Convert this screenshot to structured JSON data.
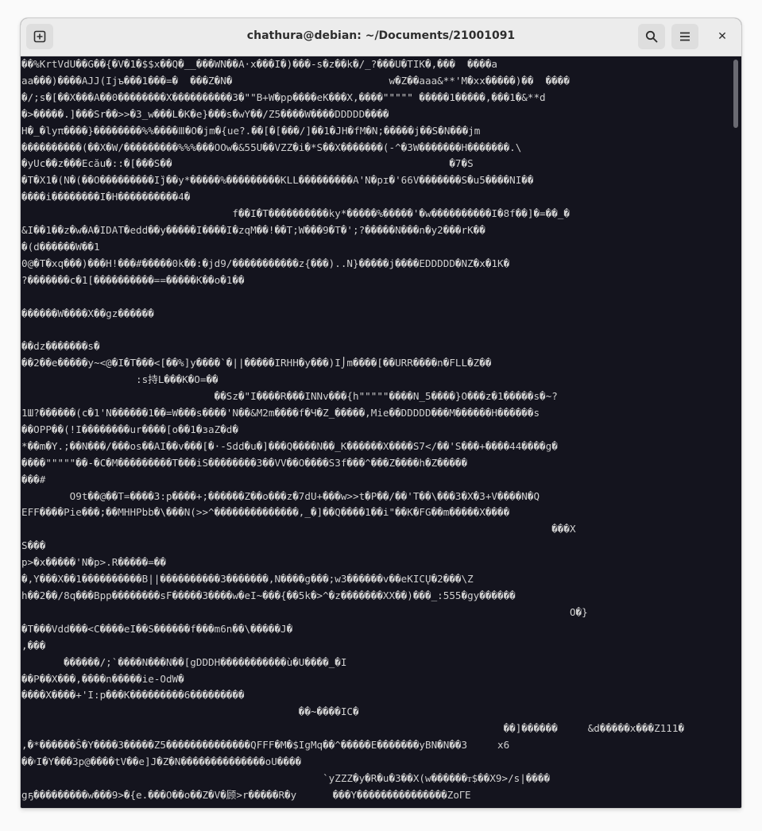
{
  "window": {
    "title": "chathura@debian: ~/Documents/21001091"
  },
  "header": {
    "new_tab_icon": "plus-square-icon",
    "search_icon": "magnifier-icon",
    "menu_icon": "hamburger-icon",
    "close_label": "✕"
  },
  "terminal": {
    "lines": [
      "��%KrtVdU��G��{�V�1�$$x��Q�__���WN��A·x���I�)���-s�z��k�/_?���U�TIK�,���  ����a",
      "aa���)����AJJ(Ijъ���1���=�  ���Z�N�                          w�Z��aaa&**'M�xx�����)��  ����",
      "�/;s�[��X���A��0��������X����������3�\"\"B+W�pp����eK���X,����\"\"\"\"\" �����1�����,���1�&**d",
      "�>�����.]���Sr��>>�3_w���L�K�e}���s�wY��/Z5����W����DDDDD����",
      "H�_�lyπ����}��������%%����Ⅲ�O�jm�{ue?.��[�[���/]��1�JH�fM�N;�����j��S�N���jm",
      "����������(��X�W/���������%%%���OOw�&55U��VZZ�i�*S��X�������(-^�3W�������H�������.\\",
      "�yUc��z���Ecău�::�[���S��                                              �7�S",
      "�T�X1�(N�(��O���������Ij̏��y*�����%���������KLL���������A'N�pɪ�'66V�������S�u5����NI��",
      "����i��������I�H����������4�",
      "                                   f��I�T����������ky*�����%�����'�w����������I�8f��]�=��_�",
      "&I��1��z�w�A�IDAT�edd��y�����I����I�zqM��!��T;W���9�T�';?�����N���n�y2���rK��",
      "�(d������W��1",
      "0@�T�xq���)���H!���#�����0k��:�јd9/�����������z{���)..N}�����j����EDDDDD�NZ�x�1K�",
      "?�������c�1[����������==�����K��o�1��",
      "",
      "������W����X��gz������",
      "",
      "��dz�������s�",
      "��2��e�����y~<@�I�T���<[��%]y����`�||�����IRHH�y���)I⌡m����[��URR����n�FLL�Z��",
      "                   :s持L���K�O=��",
      "                                ��Sz�\"I����R���INNv���{h\"\"\"\"\"����N_5����}O���z�1�����s�~?",
      "1Ш?������(c�1'N������1��=W���s����'N��&M2m����f�Ч�Z_�����,Mie��DDDDD���M������H������s",
      "��OPP��(!I��������ur����[o��1�ɜaZ�d�",
      "*��m�Y.;��N���/���os��AI��v���[�·-Sdd�u�]���Q����N��_K������X����S7</��'S���+����44����g�",
      "����\"\"\"\"\"��-�C�M���������T���iS��������3��VV��O����S3f���^���Z����h�Z�����",
      "���#",
      "        O9t��@��T=����3:p����+;������Z��o���z�7dU+���w>>t�P��/��'T��\\���3�X�3+V����N�Q",
      "EFF����Pie���;��MHHPbb�\\���N(>>^��������������,_�]��Q����1��i\"��K�FG��m�����X����",
      "                                                                                        ���X",
      "S���",
      "p>�x�����'N�p>.R�����=��",
      "�,Y���X��1����������B||����������3�������,N����g���;w3������v��eKICŲ�2���\\Z",
      "h��2��/8q���Bpp��������sF�����3����w�eI~���{��5k�>^�z�������XX��)���_:555�gy������",
      "                                                                                           O�}",
      "�T���Vdd���<C����eI��S������f���m6n��\\�����J�",
      ",���",
      "       ������/;`����N���N��[gDDDH�����������ù�U����_�I",
      "��P��X���,����n�����ie-OdW�",
      "����X����+'I:p���K���������6���������",
      "                                              ��~����IC�",
      "                                                                                ��]������     &d�����x���Z111�",
      ",�*������Ŝ�Y����3�����Z5��������������QFFF�M�$IgMq��^�����E�������yBN�N��3     x6",
      "��ᵞI�Y���3p@����tV��e]J�Z�N��������������oU����",
      "                                                  `yZZZ�y�R�u�3��X(w������ᴛ$��X9>/s|����",
      "gҕ���������w���9>�{e.���O��o��Z�V�顾>r�����R�y      ���Y���������������ZoᒥE"
    ]
  }
}
